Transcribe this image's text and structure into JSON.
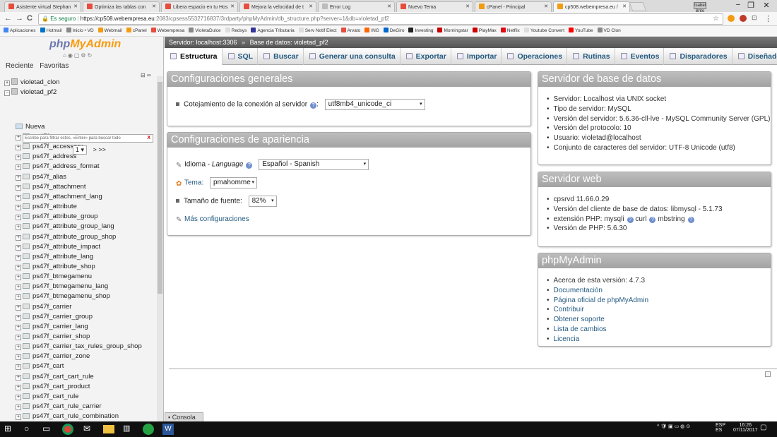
{
  "browser": {
    "tabs": [
      {
        "title": "Asistente virtual Stephan",
        "favicon_color": "#e74c3c"
      },
      {
        "title": "Optimiza las tablas con",
        "favicon_color": "#e74c3c"
      },
      {
        "title": "Libera espacio en tu Hos",
        "favicon_color": "#e74c3c"
      },
      {
        "title": "Mejora la velocidad de t",
        "favicon_color": "#e74c3c"
      },
      {
        "title": "Error Log",
        "favicon_color": "#bbbbbb"
      },
      {
        "title": "Nuevo Tema",
        "favicon_color": "#e74c3c"
      },
      {
        "title": "cPanel - Principal",
        "favicon_color": "#f39c12"
      },
      {
        "title": "cp508.webempresa.eu /",
        "favicon_color": "#f39c12"
      }
    ],
    "user_badge": "Isabel Brito",
    "window_controls": {
      "minimize": "−",
      "maximize": "❐",
      "close": "✕"
    },
    "nav": {
      "back": "←",
      "forward": "→",
      "reload": "C"
    },
    "secure_label": "Es seguro",
    "url_main": "https://cp508.webempresa.eu",
    "url_rest": ":2083/cpsess5532716837/3rdparty/phpMyAdmin/db_structure.php?server=1&db=violetad_pf2",
    "bookmarks": [
      {
        "label": "Aplicaciones",
        "color": "#4285f4"
      },
      {
        "label": "Hotmail",
        "color": "#0072c6"
      },
      {
        "label": "Inicio • VD",
        "color": "#888888"
      },
      {
        "label": "Webmail",
        "color": "#f39c12"
      },
      {
        "label": "cPanel",
        "color": "#f39c12"
      },
      {
        "label": "Webempresa",
        "color": "#e74c3c"
      },
      {
        "label": "VioletaDulce",
        "color": "#888888"
      },
      {
        "label": "Redsys",
        "color": "#dddddd"
      },
      {
        "label": "Agencia Tributaria",
        "color": "#333399"
      },
      {
        "label": "Serv Notif Elect",
        "color": "#dddddd"
      },
      {
        "label": "Arvato",
        "color": "#e74c3c"
      },
      {
        "label": "ING",
        "color": "#ff6600"
      },
      {
        "label": "DeGiro",
        "color": "#0066cc"
      },
      {
        "label": "Investing",
        "color": "#222222"
      },
      {
        "label": "Morningstar",
        "color": "#cc0000"
      },
      {
        "label": "PlayMax",
        "color": "#cc0000"
      },
      {
        "label": "Netflix",
        "color": "#e50914"
      },
      {
        "label": "Youtube Convert",
        "color": "#dddddd"
      },
      {
        "label": "YouTube",
        "color": "#ff0000"
      },
      {
        "label": "VD Clon",
        "color": "#888888"
      }
    ]
  },
  "left": {
    "logo_php": "php",
    "logo_my": "MyAdmin",
    "recent": "Reciente",
    "favorites": "Favoritas",
    "databases": [
      {
        "exp": "+",
        "name": "violetad_clon"
      },
      {
        "exp": "−",
        "name": "violetad_pf2"
      }
    ],
    "filter_placeholder": "Escribe para filtrar estos, «Enter» para buscar todo",
    "filter_clear": "X",
    "page_value": "1",
    "page_next": "> >>",
    "new_label": "Nueva",
    "tables": [
      "ps47f_access",
      "ps47f_accessory",
      "ps47f_address",
      "ps47f_address_format",
      "ps47f_alias",
      "ps47f_attachment",
      "ps47f_attachment_lang",
      "ps47f_attribute",
      "ps47f_attribute_group",
      "ps47f_attribute_group_lang",
      "ps47f_attribute_group_shop",
      "ps47f_attribute_impact",
      "ps47f_attribute_lang",
      "ps47f_attribute_shop",
      "ps47f_btmegamenu",
      "ps47f_btmegamenu_lang",
      "ps47f_btmegamenu_shop",
      "ps47f_carrier",
      "ps47f_carrier_group",
      "ps47f_carrier_lang",
      "ps47f_carrier_shop",
      "ps47f_carrier_tax_rules_group_shop",
      "ps47f_carrier_zone",
      "ps47f_cart",
      "ps47f_cart_cart_rule",
      "ps47f_cart_product",
      "ps47f_cart_rule",
      "ps47f_cart_rule_carrier",
      "ps47f_cart_rule_combination"
    ]
  },
  "main": {
    "breadcrumb_server": "Servidor: localhost:3306",
    "breadcrumb_sep": "»",
    "breadcrumb_db": "Base de datos: violetad_pf2",
    "menu": [
      "Estructura",
      "SQL",
      "Buscar",
      "Generar una consulta",
      "Exportar",
      "Importar",
      "Operaciones",
      "Rutinas",
      "Eventos",
      "Disparadores",
      "Diseñador"
    ],
    "general": {
      "title": "Configuraciones generales",
      "collation_label": "Cotejamiento de la conexión al servidor",
      "collation_value": "utf8mb4_unicode_ci"
    },
    "appearance": {
      "title": "Configuraciones de apariencia",
      "language_label": "Idioma - ",
      "language_label_italic": "Language",
      "language_value": "Español - Spanish",
      "theme_label": "Tema:",
      "theme_value": "pmahomme",
      "font_label": "Tamaño de fuente:",
      "font_value": "82%",
      "more_label": "Más configuraciones"
    },
    "db_server": {
      "title": "Servidor de base de datos",
      "items": [
        "Servidor: Localhost via UNIX socket",
        "Tipo de servidor: MySQL",
        "Versión del servidor: 5.6.36-cll-lve - MySQL Community Server (GPL)",
        "Versión del protocolo: 10",
        "Usuario: violetad@localhost",
        "Conjunto de caracteres del servidor: UTF-8 Unicode (utf8)"
      ]
    },
    "web_server": {
      "title": "Servidor web",
      "item1": "cpsrvd 11.66.0.29",
      "item2": "Versión del cliente de base de datos: libmysql - 5.1.73",
      "item3_a": "extensión PHP: mysqli",
      "item3_b": "curl",
      "item3_c": "mbstring",
      "item4": "Versión de PHP: 5.6.30"
    },
    "pma": {
      "title": "phpMyAdmin",
      "version": "Acerca de esta versión: 4.7.3",
      "links": [
        "Documentación",
        "Página oficial de phpMyAdmin",
        "Contribuir",
        "Obtener soporte",
        "Lista de cambios",
        "Licencia"
      ]
    },
    "console_label": "Consola"
  },
  "taskbar": {
    "lang_top": "ESP",
    "lang_bottom": "ES",
    "time": "16:26",
    "date": "07/11/2017"
  }
}
